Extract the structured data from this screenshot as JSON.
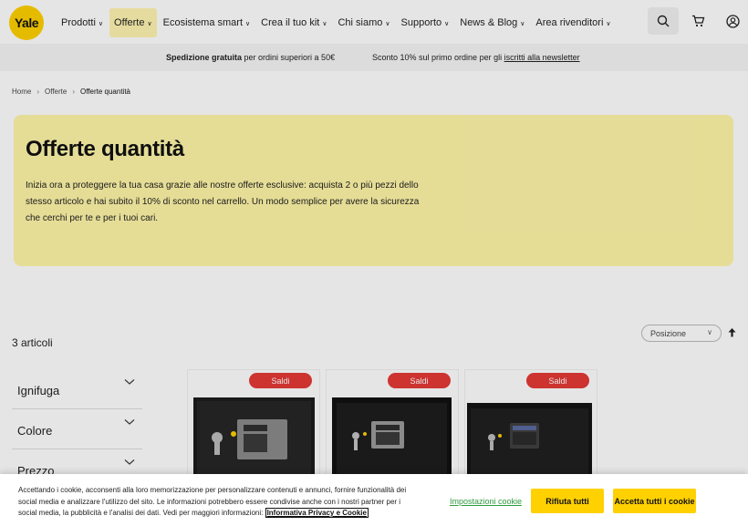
{
  "brand": {
    "logo_text": "Yale",
    "accent": "#ffd100"
  },
  "nav": {
    "items": [
      {
        "label": "Prodotti"
      },
      {
        "label": "Offerte"
      },
      {
        "label": "Ecosistema smart"
      },
      {
        "label": "Crea il tuo kit"
      },
      {
        "label": "Chi siamo"
      },
      {
        "label": "Supporto"
      },
      {
        "label": "News & Blog"
      },
      {
        "label": "Area rivenditori"
      }
    ],
    "icons": [
      "search-icon",
      "cart-icon",
      "account-icon"
    ]
  },
  "promo": {
    "shipping_bold": "Spedizione gratuita",
    "shipping_rest": " per ordini superiori a 50€",
    "newsletter_text": "Sconto 10% sul primo ordine per gli ",
    "newsletter_link": "iscritti alla newsletter"
  },
  "breadcrumb": {
    "home": "Home",
    "offers": "Offerte",
    "current": "Offerte quantità"
  },
  "hero": {
    "title": "Offerte quantità",
    "description": "Inizia ora a proteggere la tua casa grazie alle nostre offerte esclusive: acquista 2 o più pezzi dello stesso articolo e hai subito il 10% di sconto nel carrello. Un modo semplice per avere la sicurezza che cerchi per te e per i tuoi cari."
  },
  "listing": {
    "count": "3 articoli",
    "sort_value": "Posizione",
    "sort_direction_icon": "arrow-up-icon"
  },
  "filters": [
    {
      "label": "Ignifuga"
    },
    {
      "label": "Colore"
    },
    {
      "label": "Prezzo"
    }
  ],
  "products": [
    {
      "badge": "Saldi"
    },
    {
      "badge": "Saldi"
    },
    {
      "badge": "Saldi"
    }
  ],
  "cookie": {
    "text_before_link": "Accettando i cookie, acconsenti alla loro memorizzazione per personalizzare contenuti e annunci, fornire funzionalità dei social media e analizzare l'utilizzo del sito. Le informazioni potrebbero essere condivise anche con i nostri partner per i social media, la pubblicità e l'analisi dei dati. Vedi per maggiori informazioni: ",
    "policy_link": "Informativa Privacy e Cookie",
    "settings_label": "Impostazioni cookie",
    "reject_label": "Rifiuta tutti",
    "accept_label": "Accetta tutti i cookie"
  },
  "colors": {
    "badge": "#e53935",
    "hero_bg": "#fff6a8",
    "settings_link": "#2e9b3f"
  }
}
